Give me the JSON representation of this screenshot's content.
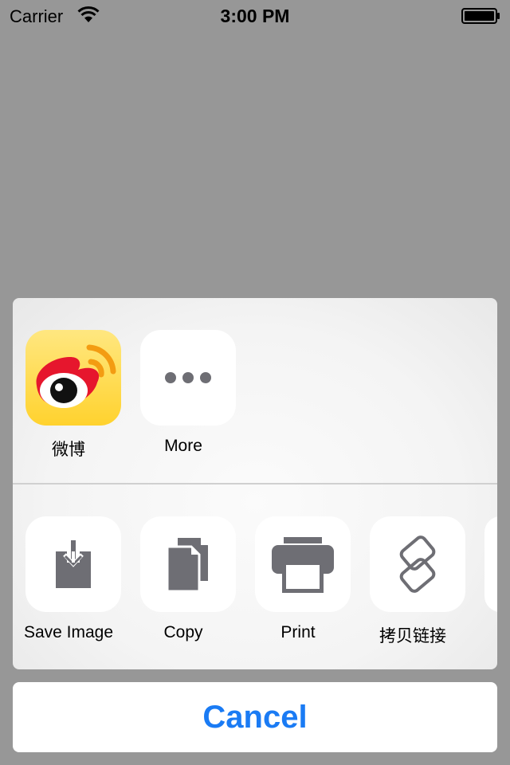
{
  "status_bar": {
    "carrier": "Carrier",
    "time": "3:00 PM"
  },
  "share_sheet": {
    "apps": [
      {
        "label": "微博",
        "icon": "weibo-icon"
      },
      {
        "label": "More",
        "icon": "more-dots-icon"
      }
    ],
    "actions": [
      {
        "label": "Save Image",
        "icon": "save-image-icon"
      },
      {
        "label": "Copy",
        "icon": "copy-icon"
      },
      {
        "label": "Print",
        "icon": "print-icon"
      },
      {
        "label": "拷贝链接",
        "icon": "link-icon"
      }
    ]
  },
  "cancel_label": "Cancel",
  "colors": {
    "backdrop": "#979797",
    "accent": "#1a7bf4",
    "icon_gray": "#6e6e74",
    "weibo_red": "#e6162d",
    "weibo_yellow": "#ffd22e"
  }
}
